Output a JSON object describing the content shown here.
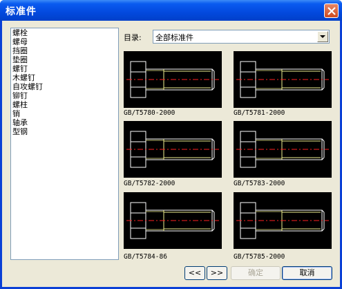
{
  "window": {
    "title": "标准件"
  },
  "category_list": [
    "螺栓",
    "螺母",
    "挡圈",
    "垫圈",
    "螺钉",
    "木螺钉",
    "自攻螺钉",
    "铆钉",
    "螺柱",
    "销",
    "轴承",
    "型钢"
  ],
  "directory": {
    "label": "目录:",
    "selected": "全部标准件"
  },
  "thumbnails": [
    {
      "caption": "GB/T5780-2000"
    },
    {
      "caption": "GB/T5781-2000"
    },
    {
      "caption": "GB/T5782-2000"
    },
    {
      "caption": "GB/T5783-2000"
    },
    {
      "caption": "GB/T5784-86"
    },
    {
      "caption": "GB/T5785-2000"
    }
  ],
  "buttons": {
    "prev": "<<",
    "next": ">>",
    "ok": "确定",
    "cancel": "取消"
  },
  "colors": {
    "drawing_line": "#f0f090",
    "center_line": "#ff2020",
    "thumb_bg": "#000000"
  },
  "icons": {
    "close": "close-icon",
    "dropdown": "chevron-down-icon"
  }
}
